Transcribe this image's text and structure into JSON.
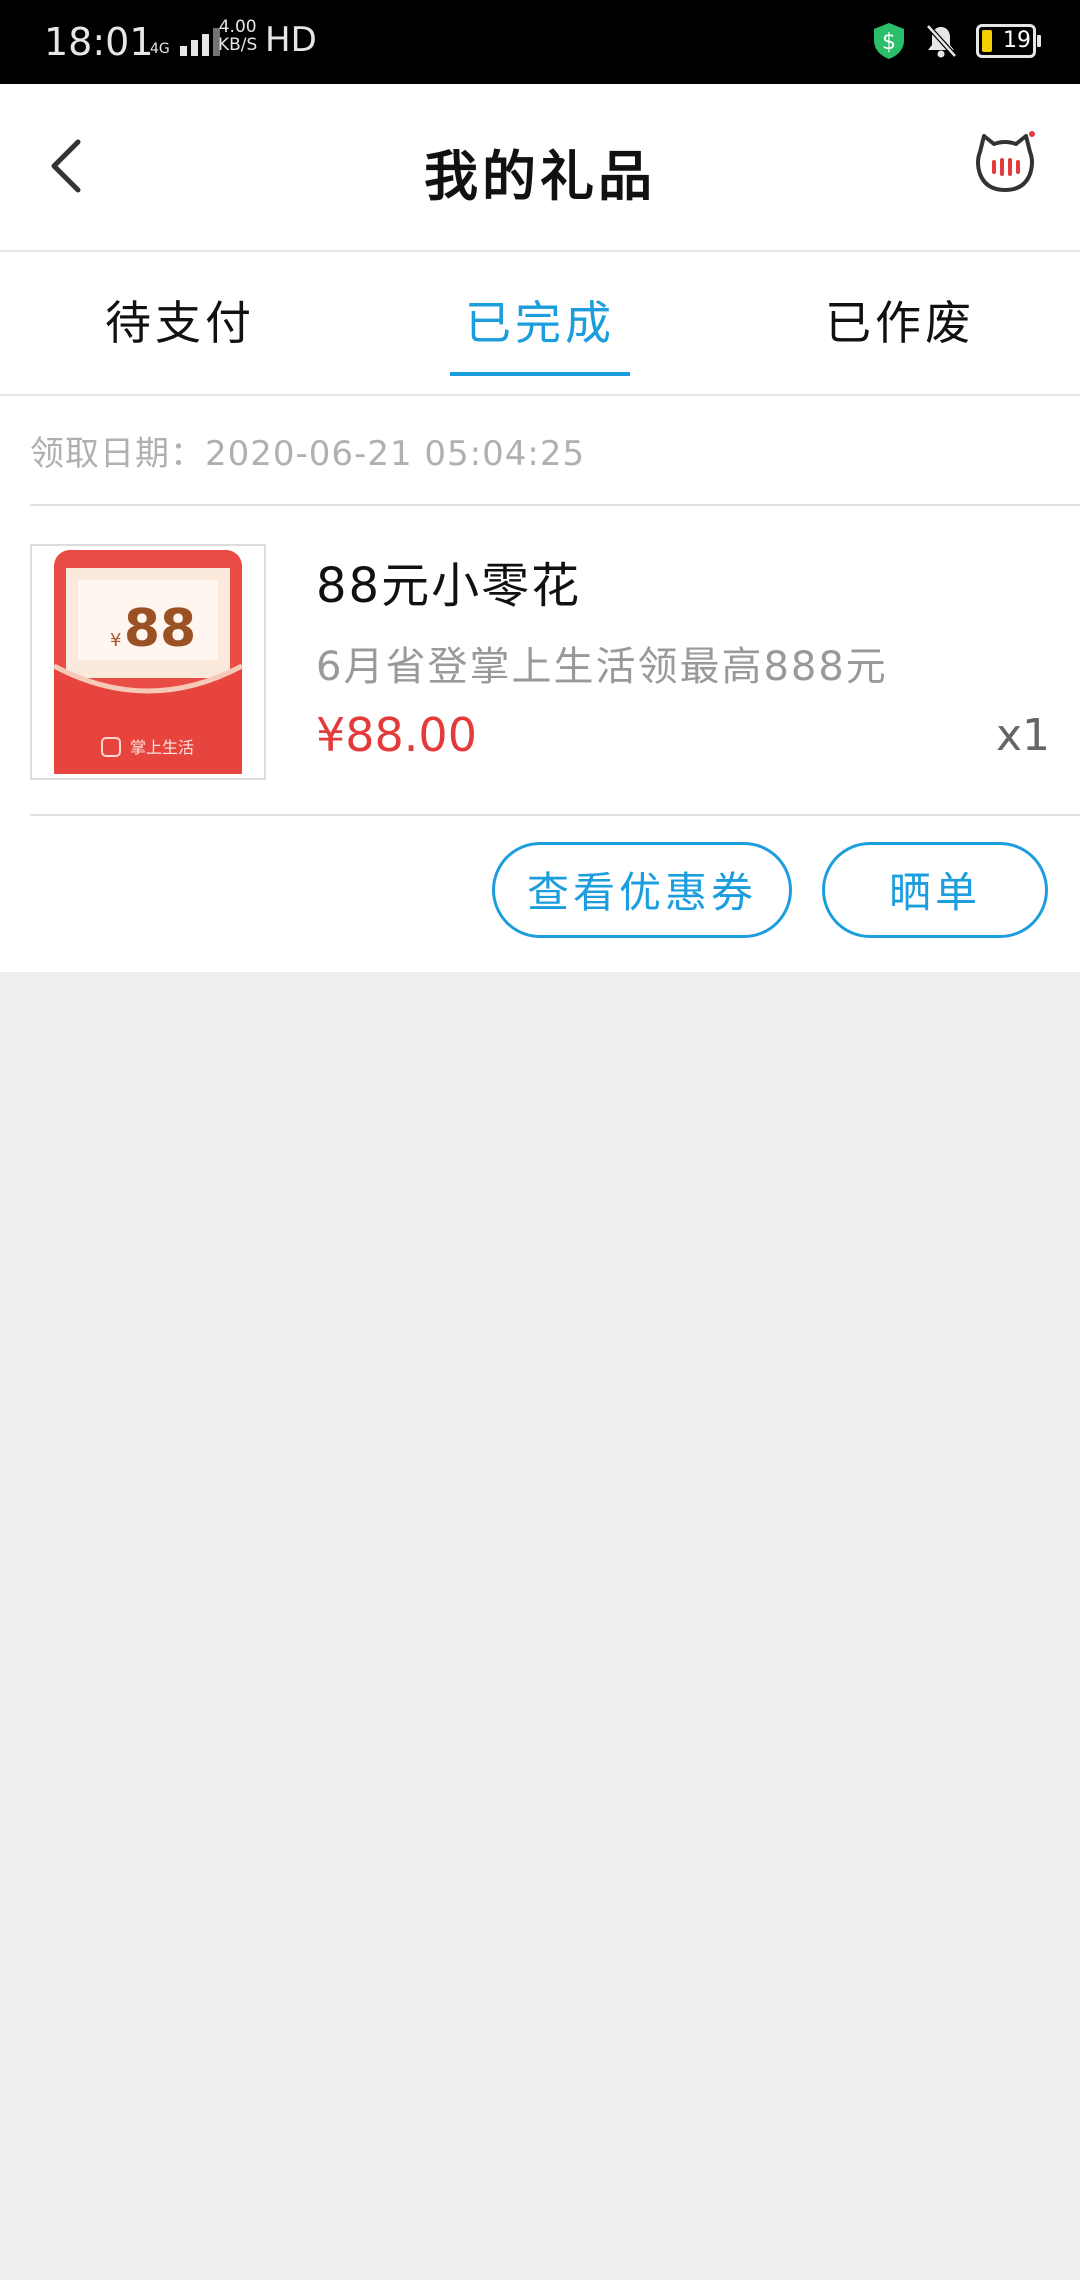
{
  "status_bar": {
    "time": "18:01",
    "network": "4G",
    "speed_value": "4.00",
    "speed_unit": "KB/S",
    "hd": "HD",
    "battery": "19"
  },
  "header": {
    "title": "我的礼品"
  },
  "tabs": [
    {
      "label": "待支付",
      "active": false
    },
    {
      "label": "已完成",
      "active": true
    },
    {
      "label": "已作废",
      "active": false
    }
  ],
  "order": {
    "date_label": "领取日期：2020-06-21 05:04:25",
    "thumbnail": {
      "amount_symbol": "¥",
      "amount": "88",
      "brand": "掌上生活"
    },
    "product_name": "88元小零花",
    "product_desc": "6月省登掌上生活领最高888元",
    "price": "¥88.00",
    "quantity": "x1",
    "actions": {
      "view_coupon": "查看优惠券",
      "share": "晒单"
    }
  },
  "colors": {
    "accent": "#1c9ddd",
    "price": "#e33b3b",
    "background": "#eeeeee"
  }
}
